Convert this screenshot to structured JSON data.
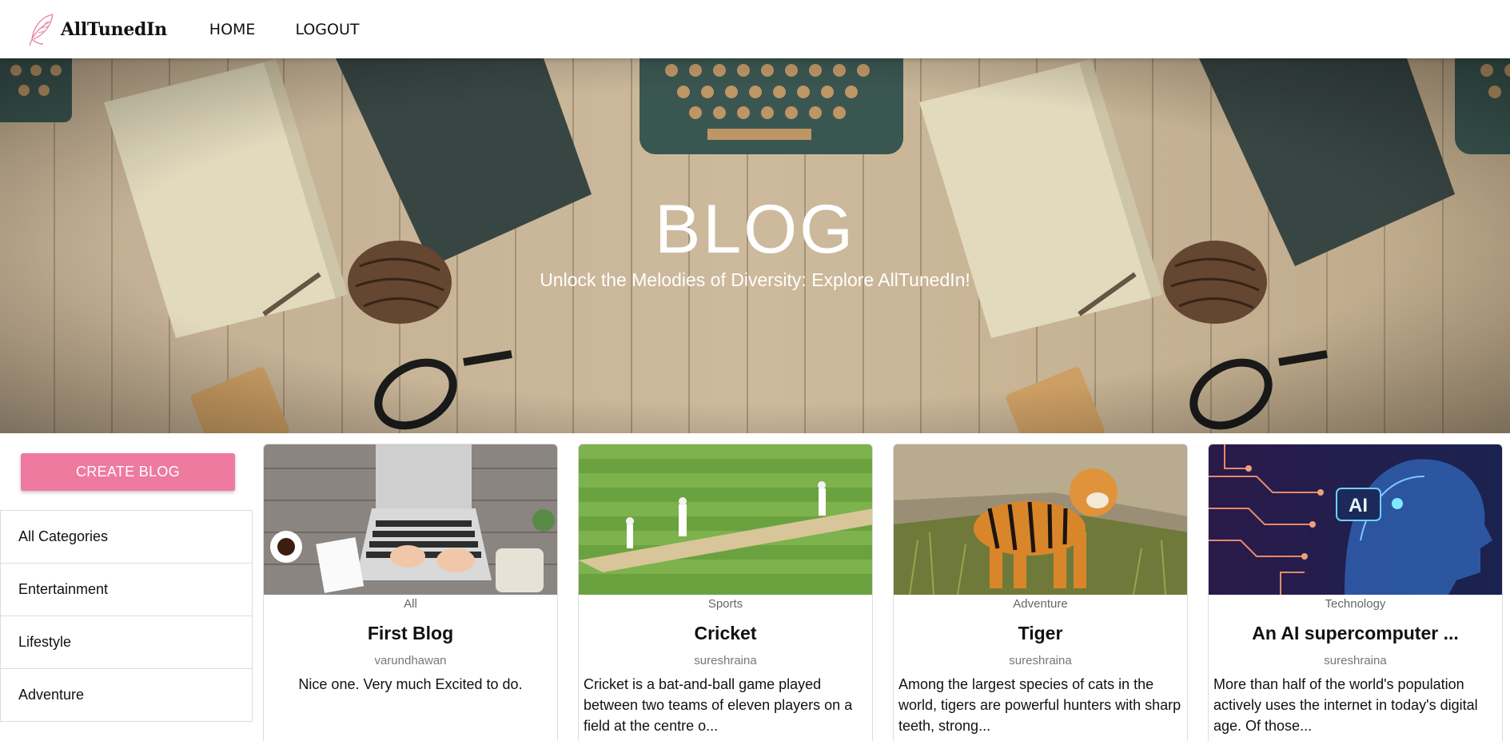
{
  "brand": {
    "name": "AllTunedIn",
    "accent": "#ee7aa0"
  },
  "nav": {
    "items": [
      {
        "label": "HOME"
      },
      {
        "label": "LOGOUT"
      }
    ]
  },
  "hero": {
    "title": "BLOG",
    "subtitle": "Unlock the Melodies of Diversity: Explore AllTunedIn!"
  },
  "sidebar": {
    "create_label": "CREATE BLOG",
    "categories": [
      {
        "label": "All Categories"
      },
      {
        "label": "Entertainment"
      },
      {
        "label": "Lifestyle"
      },
      {
        "label": "Adventure"
      }
    ]
  },
  "posts": [
    {
      "category": "All",
      "title": "First Blog",
      "author": "varundhawan",
      "description": "Nice one. Very much Excited to do.",
      "image": "laptop-desk-photo"
    },
    {
      "category": "Sports",
      "title": "Cricket",
      "author": "sureshraina",
      "description": "Cricket is a bat-and-ball game played between two teams of eleven players on a field at the centre o...",
      "image": "cricket-field-photo"
    },
    {
      "category": "Adventure",
      "title": "Tiger",
      "author": "sureshraina",
      "description": "Among the largest species of cats in the world, tigers are powerful hunters with sharp teeth, strong...",
      "image": "tiger-photo"
    },
    {
      "category": "Technology",
      "title": "An AI supercomputer ...",
      "author": "sureshraina",
      "description": "More than half of the world's population actively uses the internet in today's digital age. Of those...",
      "image": "ai-head-photo",
      "image_text": "AI"
    }
  ]
}
